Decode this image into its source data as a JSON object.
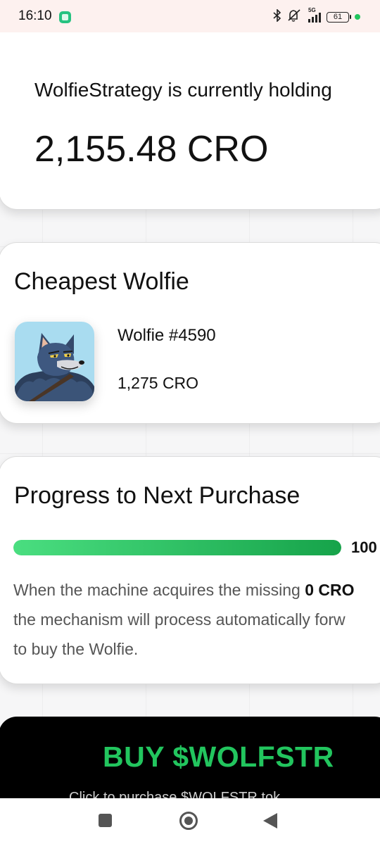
{
  "status_bar": {
    "time": "16:10",
    "network": "5G",
    "battery": "61",
    "icons": [
      "app-icon",
      "bluetooth-icon",
      "mute-icon",
      "signal-icon",
      "battery-icon",
      "status-dot-icon"
    ]
  },
  "holding": {
    "label": "WolfieStrategy is currently holding",
    "value": "2,155.48 CRO"
  },
  "cheapest": {
    "title": "Cheapest Wolfie",
    "name": "Wolfie #4590",
    "price": "1,275 CRO"
  },
  "progress": {
    "title": "Progress to Next Purchase",
    "percent_label": "100",
    "fraction": 1.0,
    "text_before": "When the machine acquires the missing ",
    "text_amount": "0 CRO",
    "line2": "the mechanism will process automatically forw",
    "line3": "to buy the Wolfie."
  },
  "buy": {
    "title": "BUY $WOLFSTR",
    "subtitle": "Click to purchase $WOLFSTR tok"
  },
  "colors": {
    "accent_green": "#22c55e",
    "progress_start": "#4ade80",
    "progress_end": "#16a34a",
    "status_bar_bg": "#fdf1ef"
  },
  "nav": {
    "icons": [
      "recents-icon",
      "home-icon",
      "back-icon"
    ]
  }
}
